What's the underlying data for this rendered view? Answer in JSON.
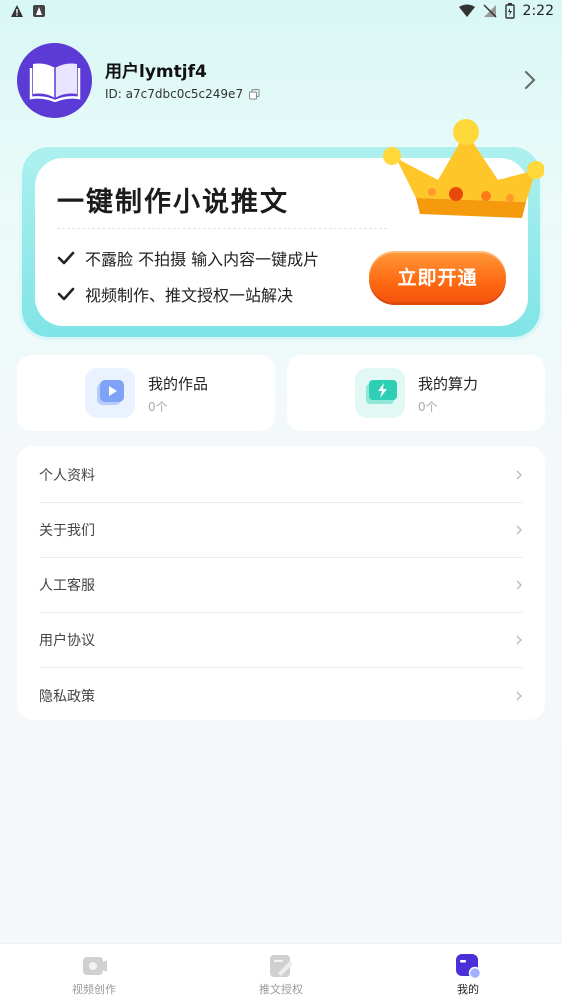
{
  "status_bar": {
    "time": "2:22"
  },
  "profile": {
    "username": "用户lymtjf4",
    "user_id": "ID: a7c7dbc0c5c249e7"
  },
  "banner": {
    "title": "一键制作小说推文",
    "features": [
      "不露脸 不拍摄 输入内容一键成片",
      "视频制作、推文授权一站解决"
    ],
    "cta_label": "立即开通"
  },
  "stats": [
    {
      "title": "我的作品",
      "count": "0个",
      "icon": "video-play-icon"
    },
    {
      "title": "我的算力",
      "count": "0个",
      "icon": "lightning-icon"
    }
  ],
  "menu": {
    "items": [
      "个人资料",
      "关于我们",
      "人工客服",
      "用户协议",
      "隐私政策"
    ]
  },
  "bottom_nav": {
    "items": [
      {
        "label": "视频创作",
        "icon": "video-create-icon",
        "active": false
      },
      {
        "label": "推文授权",
        "icon": "authorize-icon",
        "active": false
      },
      {
        "label": "我的",
        "icon": "profile-icon",
        "active": true
      }
    ]
  },
  "colors": {
    "accent": "#5b3ad6",
    "cta_orange": "#ff6a12",
    "banner_cyan": "#7fe3e6"
  }
}
